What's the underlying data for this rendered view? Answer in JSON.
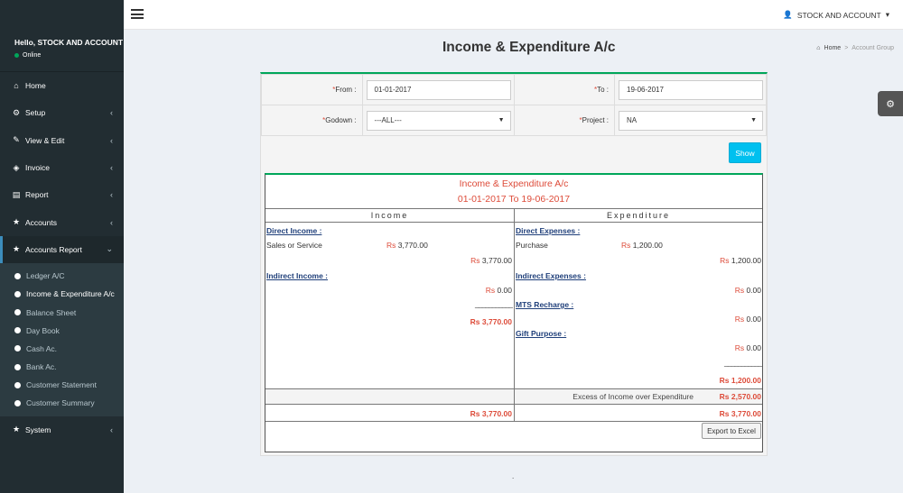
{
  "user": {
    "greeting": "Hello, STOCK AND ACCOUNT",
    "status": "Online",
    "top_name": "STOCK AND ACCOUNT"
  },
  "menu": [
    {
      "label": "Home",
      "icon": "home-icon"
    },
    {
      "label": "Setup",
      "icon": "cogs-icon"
    },
    {
      "label": "View & Edit",
      "icon": "edit-icon"
    },
    {
      "label": "Invoice",
      "icon": "invoice-icon"
    },
    {
      "label": "Report",
      "icon": "file-icon"
    },
    {
      "label": "Accounts",
      "icon": "star-icon"
    },
    {
      "label": "Accounts Report",
      "icon": "star-icon"
    }
  ],
  "submenu": [
    "Ledger A/C",
    "Income & Expenditure A/c",
    "Balance Sheet",
    "Day Book",
    "Cash Ac.",
    "Bank Ac.",
    "Customer Statement",
    "Customer Summary"
  ],
  "menu_last": {
    "label": "System",
    "icon": "star-icon"
  },
  "page": {
    "title": "Income & Expenditure A/c"
  },
  "breadcrumb": {
    "home": "Home",
    "sep": ">",
    "current": "Account Group"
  },
  "filters": {
    "from_label": "From :",
    "from_value": "01-01-2017",
    "to_label": "To :",
    "to_value": "19-06-2017",
    "godown_label": "Godown :",
    "godown_value": "---ALL---",
    "project_label": "Project :",
    "project_value": "NA",
    "required_mark": "*",
    "show_label": "Show"
  },
  "report": {
    "title": "Income & Expenditure A/c",
    "period": "01-01-2017 To 19-06-2017",
    "income_header": "Income",
    "expenditure_header": "Expenditure",
    "currency": "Rs",
    "underline": "___________",
    "income": {
      "direct_label": "Direct Income :",
      "sales_label": "Sales or Service",
      "sales_amt": "3,770.00",
      "direct_total": "3,770.00",
      "indirect_label": "Indirect Income :",
      "indirect_total": "0.00",
      "total": "Rs 3,770.00"
    },
    "expenditure": {
      "direct_label": "Direct Expenses :",
      "purchase_label": "Purchase",
      "purchase_amt": "1,200.00",
      "direct_total": "1,200.00",
      "indirect_label": "Indirect Expenses :",
      "indirect_total": "0.00",
      "mts_label": "MTS Recharge :",
      "mts_total": "0.00",
      "gift_label": "Gift Purpose :",
      "gift_total": "0.00",
      "total": "Rs 1,200.00"
    },
    "excess_label": "Excess of Income over Expenditure",
    "excess_amt": "Rs 2,570.00",
    "grand_income": "Rs 3,770.00",
    "grand_expenditure": "Rs 3,770.00",
    "export_label": "Export to Excel"
  },
  "footer": {
    "dot": "."
  }
}
